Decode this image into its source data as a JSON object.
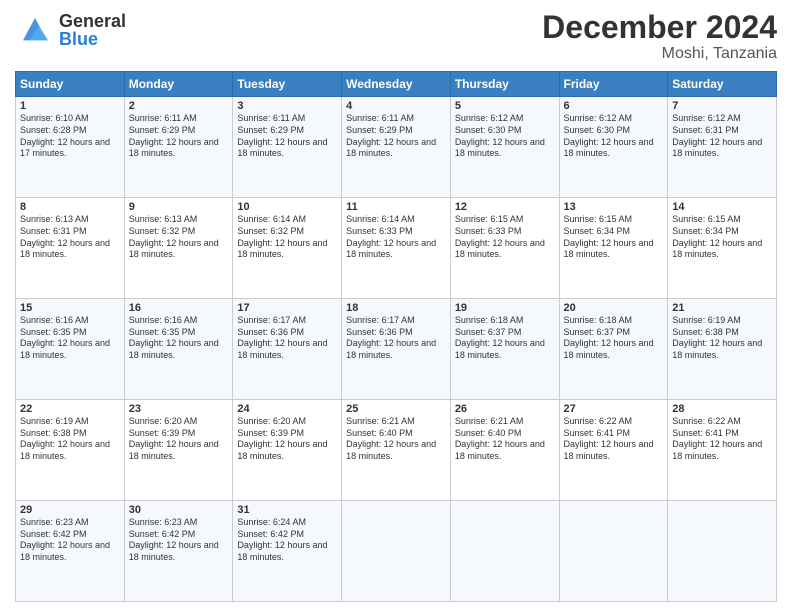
{
  "header": {
    "title": "December 2024",
    "subtitle": "Moshi, Tanzania",
    "logo_general": "General",
    "logo_blue": "Blue"
  },
  "weekdays": [
    "Sunday",
    "Monday",
    "Tuesday",
    "Wednesday",
    "Thursday",
    "Friday",
    "Saturday"
  ],
  "weeks": [
    [
      {
        "day": "1",
        "sunrise": "6:10 AM",
        "sunset": "6:28 PM",
        "daylight": "12 hours and 17 minutes."
      },
      {
        "day": "2",
        "sunrise": "6:11 AM",
        "sunset": "6:29 PM",
        "daylight": "12 hours and 18 minutes."
      },
      {
        "day": "3",
        "sunrise": "6:11 AM",
        "sunset": "6:29 PM",
        "daylight": "12 hours and 18 minutes."
      },
      {
        "day": "4",
        "sunrise": "6:11 AM",
        "sunset": "6:29 PM",
        "daylight": "12 hours and 18 minutes."
      },
      {
        "day": "5",
        "sunrise": "6:12 AM",
        "sunset": "6:30 PM",
        "daylight": "12 hours and 18 minutes."
      },
      {
        "day": "6",
        "sunrise": "6:12 AM",
        "sunset": "6:30 PM",
        "daylight": "12 hours and 18 minutes."
      },
      {
        "day": "7",
        "sunrise": "6:12 AM",
        "sunset": "6:31 PM",
        "daylight": "12 hours and 18 minutes."
      }
    ],
    [
      {
        "day": "8",
        "sunrise": "6:13 AM",
        "sunset": "6:31 PM",
        "daylight": "12 hours and 18 minutes."
      },
      {
        "day": "9",
        "sunrise": "6:13 AM",
        "sunset": "6:32 PM",
        "daylight": "12 hours and 18 minutes."
      },
      {
        "day": "10",
        "sunrise": "6:14 AM",
        "sunset": "6:32 PM",
        "daylight": "12 hours and 18 minutes."
      },
      {
        "day": "11",
        "sunrise": "6:14 AM",
        "sunset": "6:33 PM",
        "daylight": "12 hours and 18 minutes."
      },
      {
        "day": "12",
        "sunrise": "6:15 AM",
        "sunset": "6:33 PM",
        "daylight": "12 hours and 18 minutes."
      },
      {
        "day": "13",
        "sunrise": "6:15 AM",
        "sunset": "6:34 PM",
        "daylight": "12 hours and 18 minutes."
      },
      {
        "day": "14",
        "sunrise": "6:15 AM",
        "sunset": "6:34 PM",
        "daylight": "12 hours and 18 minutes."
      }
    ],
    [
      {
        "day": "15",
        "sunrise": "6:16 AM",
        "sunset": "6:35 PM",
        "daylight": "12 hours and 18 minutes."
      },
      {
        "day": "16",
        "sunrise": "6:16 AM",
        "sunset": "6:35 PM",
        "daylight": "12 hours and 18 minutes."
      },
      {
        "day": "17",
        "sunrise": "6:17 AM",
        "sunset": "6:36 PM",
        "daylight": "12 hours and 18 minutes."
      },
      {
        "day": "18",
        "sunrise": "6:17 AM",
        "sunset": "6:36 PM",
        "daylight": "12 hours and 18 minutes."
      },
      {
        "day": "19",
        "sunrise": "6:18 AM",
        "sunset": "6:37 PM",
        "daylight": "12 hours and 18 minutes."
      },
      {
        "day": "20",
        "sunrise": "6:18 AM",
        "sunset": "6:37 PM",
        "daylight": "12 hours and 18 minutes."
      },
      {
        "day": "21",
        "sunrise": "6:19 AM",
        "sunset": "6:38 PM",
        "daylight": "12 hours and 18 minutes."
      }
    ],
    [
      {
        "day": "22",
        "sunrise": "6:19 AM",
        "sunset": "6:38 PM",
        "daylight": "12 hours and 18 minutes."
      },
      {
        "day": "23",
        "sunrise": "6:20 AM",
        "sunset": "6:39 PM",
        "daylight": "12 hours and 18 minutes."
      },
      {
        "day": "24",
        "sunrise": "6:20 AM",
        "sunset": "6:39 PM",
        "daylight": "12 hours and 18 minutes."
      },
      {
        "day": "25",
        "sunrise": "6:21 AM",
        "sunset": "6:40 PM",
        "daylight": "12 hours and 18 minutes."
      },
      {
        "day": "26",
        "sunrise": "6:21 AM",
        "sunset": "6:40 PM",
        "daylight": "12 hours and 18 minutes."
      },
      {
        "day": "27",
        "sunrise": "6:22 AM",
        "sunset": "6:41 PM",
        "daylight": "12 hours and 18 minutes."
      },
      {
        "day": "28",
        "sunrise": "6:22 AM",
        "sunset": "6:41 PM",
        "daylight": "12 hours and 18 minutes."
      }
    ],
    [
      {
        "day": "29",
        "sunrise": "6:23 AM",
        "sunset": "6:42 PM",
        "daylight": "12 hours and 18 minutes."
      },
      {
        "day": "30",
        "sunrise": "6:23 AM",
        "sunset": "6:42 PM",
        "daylight": "12 hours and 18 minutes."
      },
      {
        "day": "31",
        "sunrise": "6:24 AM",
        "sunset": "6:42 PM",
        "daylight": "12 hours and 18 minutes."
      },
      null,
      null,
      null,
      null
    ]
  ],
  "labels": {
    "sunrise": "Sunrise:",
    "sunset": "Sunset:",
    "daylight": "Daylight:"
  }
}
